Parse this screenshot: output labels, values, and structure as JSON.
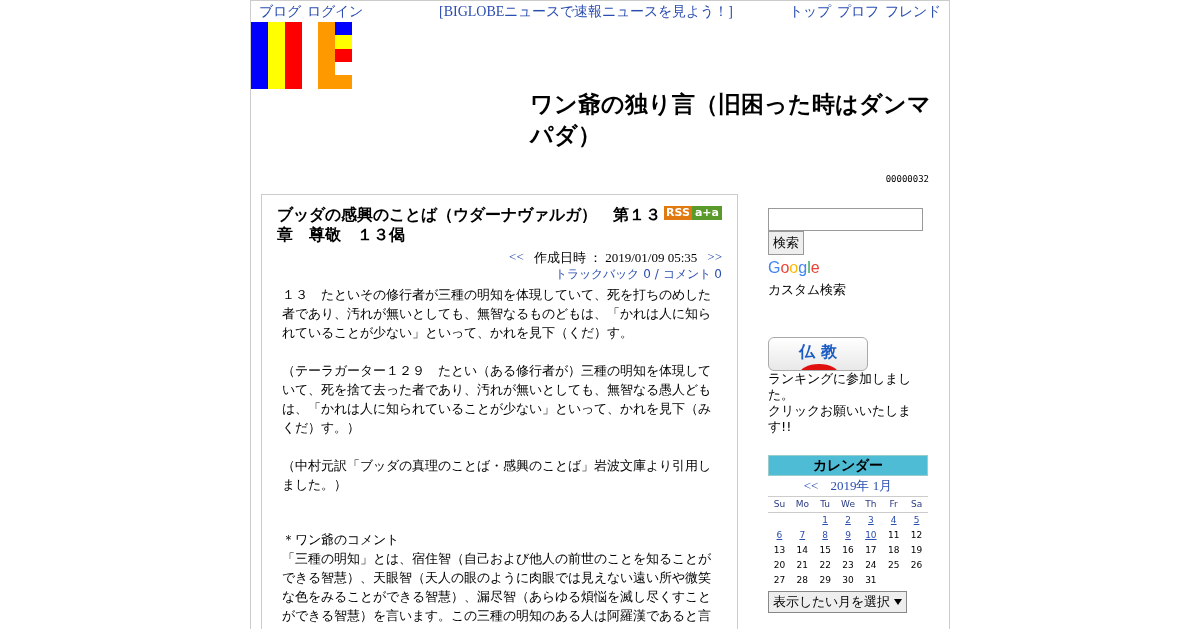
{
  "top_bar": {
    "left_links": [
      "ブログ",
      "ログイン"
    ],
    "center_link": "[BIGLOBEニュースで速報ニュースを見よう！]",
    "right_links": [
      "トップ",
      "プロフ",
      "フレンド"
    ]
  },
  "header": {
    "title": "ワン爺の独り言（旧困った時はダンマパダ）",
    "counter": "00000032"
  },
  "post": {
    "title": "ブッダの感興のことば（ウダーナヴァルガ）　第１３章　尊敬　１３偈",
    "rss_badge": "RSS",
    "share_badge": "a+a",
    "prev": "<<",
    "date_label": "作成日時 ： 2019/01/09 05:35",
    "next": ">>",
    "trackback": "トラックバック 0 / コメント 0",
    "paragraphs": [
      "１３　たといその修行者が三種の明知を体現していて、死を打ちのめした者であり、汚れが無いとしても、無智なるものどもは、「かれは人に知られていることが少ない」といって、かれを見下（くだ）す。",
      "（テーラガーター１２９　たとい（ある修行者が）三種の明知を体現していて、死を捨て去った者であり、汚れが無いとしても、無智なる愚人どもは、「かれは人に知られていることが少ない」といって、かれを見下（みくだ）す。）",
      "（中村元訳「ブッダの真理のことば・感興のことば」岩波文庫より引用しました。）",
      "＊ワン爺のコメント",
      "「三種の明知」とは、宿住智（自己および他人の前世のことを知ることができる智慧）、天眼智（天人の眼のように肉眼では見えない遠い所や微笑な色をみることができる智慧）、漏尽智（あらゆる煩悩を滅し尽くすことができる智慧）を言います。この三種の明知のある人は阿羅漢であると言"
    ]
  },
  "sidebar": {
    "search_button": "検索",
    "google_logo": "Google",
    "custom_search": "カスタム検索",
    "ranking_banner": "仏 教",
    "ranking_text": [
      "ランキングに参加しました。",
      "クリックお願いいたします!!"
    ],
    "calendar": {
      "title": "カレンダー",
      "prev": "<<",
      "month": "2019年 1月",
      "weekdays": [
        "Su",
        "Mo",
        "Tu",
        "We",
        "Th",
        "Fr",
        "Sa"
      ],
      "weeks": [
        {
          "days": [
            {
              "day": "1",
              "linked": true
            },
            {
              "day": "2",
              "linked": true
            },
            {
              "day": "3",
              "linked": true
            },
            {
              "day": "4",
              "linked": true
            },
            {
              "day": "5",
              "linked": true
            }
          ]
        },
        {
          "days": [
            {
              "day": "6",
              "linked": true
            },
            {
              "day": "7",
              "linked": true
            },
            {
              "day": "8",
              "linked": true
            },
            {
              "day": "9",
              "linked": true
            },
            {
              "day": "10",
              "linked": true
            },
            {
              "day": "11",
              "linked": false
            },
            {
              "day": "12",
              "linked": false
            }
          ]
        },
        {
          "days": [
            {
              "day": "13",
              "linked": false
            },
            {
              "day": "14",
              "linked": false
            },
            {
              "day": "15",
              "linked": false
            },
            {
              "day": "16",
              "linked": false
            },
            {
              "day": "17",
              "linked": false
            },
            {
              "day": "18",
              "linked": false
            },
            {
              "day": "19",
              "linked": false
            }
          ]
        },
        {
          "days": [
            {
              "day": "20",
              "linked": false
            },
            {
              "day": "21",
              "linked": false
            },
            {
              "day": "22",
              "linked": false
            },
            {
              "day": "23",
              "linked": false
            },
            {
              "day": "24",
              "linked": false
            },
            {
              "day": "25",
              "linked": false
            },
            {
              "day": "26",
              "linked": false
            }
          ]
        },
        {
          "days": [
            {
              "day": "27",
              "linked": false
            },
            {
              "day": "28",
              "linked": false
            },
            {
              "day": "29",
              "linked": false
            },
            {
              "day": "30",
              "linked": false
            },
            {
              "day": "31",
              "linked": false
            }
          ]
        }
      ],
      "month_select": "表示したい月を選択"
    }
  }
}
